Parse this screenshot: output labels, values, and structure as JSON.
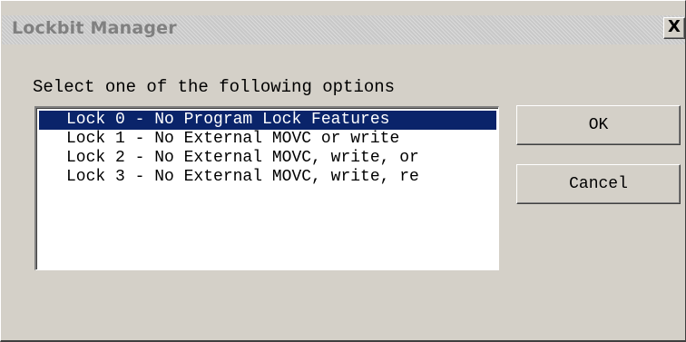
{
  "window": {
    "title": "Lockbit Manager",
    "close_label": "X"
  },
  "dialog": {
    "prompt": "Select one of the following options",
    "options": [
      {
        "label": "Lock 0 - No Program Lock Features",
        "selected": true
      },
      {
        "label": "Lock 1 - No External MOVC or write",
        "selected": false
      },
      {
        "label": "Lock 2 - No External MOVC, write, or",
        "selected": false
      },
      {
        "label": "Lock 3 - No External MOVC, write, re",
        "selected": false
      }
    ],
    "ok_label": "OK",
    "cancel_label": "Cancel"
  },
  "colors": {
    "face": "#d4d0c8",
    "selection": "#0a246a",
    "title_text": "#808080"
  }
}
